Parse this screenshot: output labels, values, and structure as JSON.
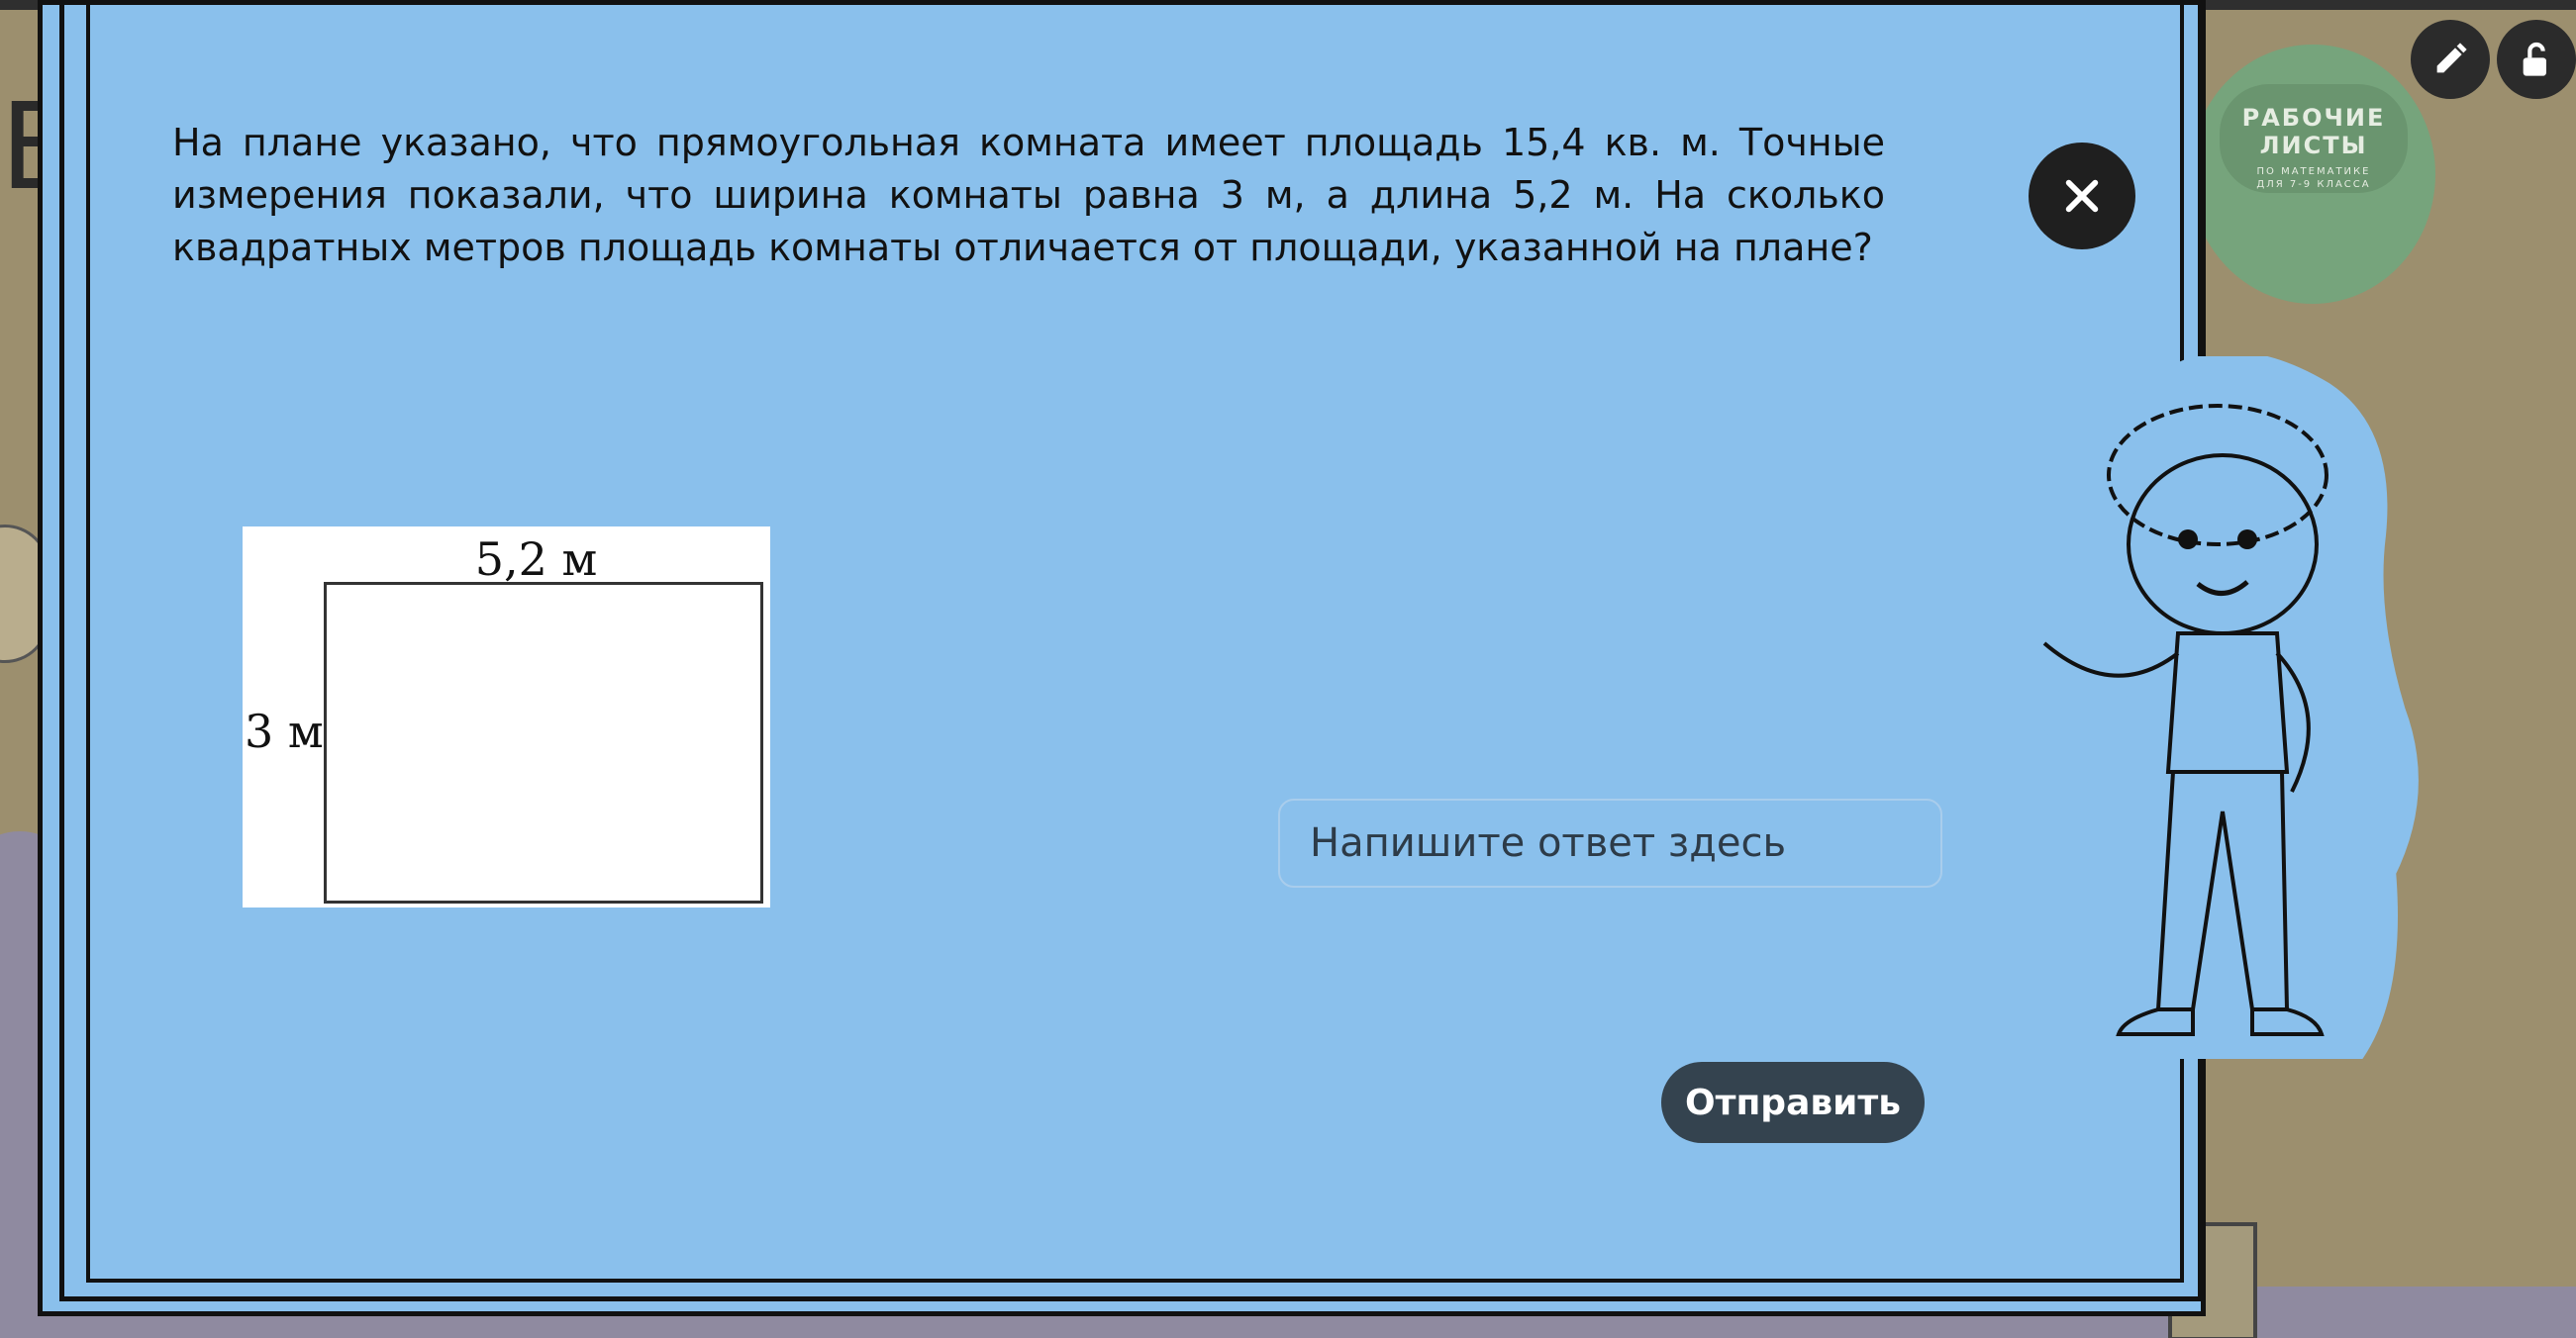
{
  "question": {
    "text": "На плане указано, что прямоугольная комната имеет площадь 15,4 кв. м. Точные измерения показали, что ширина комнаты равна 3 м, а длина 5,2 м. На сколько квадратных метров площадь комнаты отличается от площади, указанной на плане?"
  },
  "figure": {
    "top_label": "5,2 м",
    "left_label": "3 м"
  },
  "answer": {
    "placeholder": "Напишите ответ здесь",
    "value": ""
  },
  "submit": {
    "label": "Отправить"
  },
  "logo": {
    "title_line1": "РАБОЧИЕ",
    "title_line2": "ЛИСТЫ",
    "sub_line1": "ПО МАТЕМАТИКЕ",
    "sub_line2": "ДЛЯ 7-9 КЛАССА"
  },
  "background": {
    "letter": "Е"
  },
  "icons": {
    "close": "close-icon",
    "pencil": "pencil-icon",
    "unlock": "unlock-icon"
  },
  "colors": {
    "modal_bg": "#8ac0ec",
    "page_bg": "#9c8f6e",
    "button_bg": "#34434f",
    "close_bg": "#1f1f1f"
  }
}
